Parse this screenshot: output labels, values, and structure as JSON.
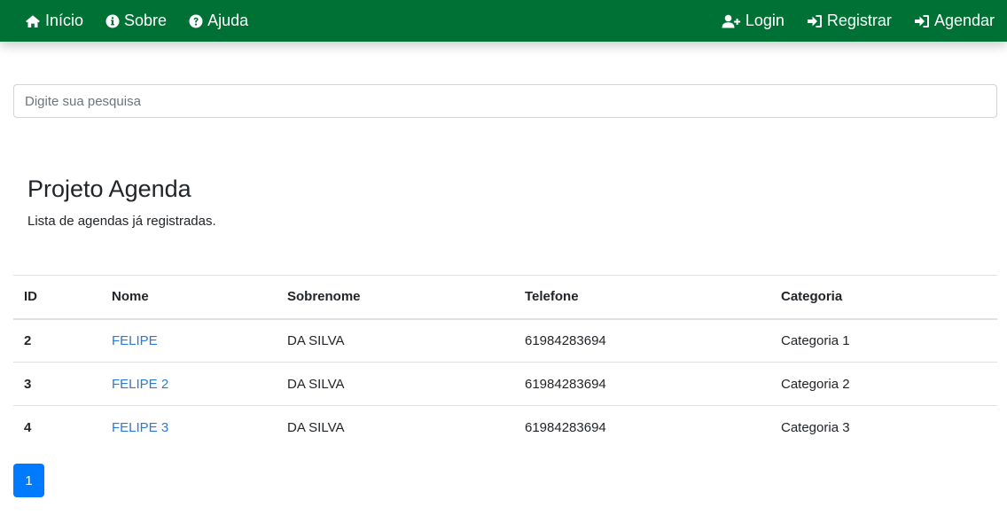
{
  "navbar": {
    "left": [
      {
        "label": "Início",
        "icon": "home-icon"
      },
      {
        "label": "Sobre",
        "icon": "info-circle-icon"
      },
      {
        "label": "Ajuda",
        "icon": "question-circle-icon"
      }
    ],
    "right": [
      {
        "label": "Login",
        "icon": "user-plus-icon"
      },
      {
        "label": "Registrar",
        "icon": "sign-in-icon"
      },
      {
        "label": "Agendar",
        "icon": "sign-in-icon"
      }
    ],
    "background_color": "#007134",
    "text_color": "#ffffff"
  },
  "search": {
    "placeholder": "Digite sua pesquisa",
    "value": ""
  },
  "header": {
    "title": "Projeto Agenda",
    "subtitle": "Lista de agendas já registradas."
  },
  "table": {
    "columns": [
      "ID",
      "Nome",
      "Sobrenome",
      "Telefone",
      "Categoria"
    ],
    "rows": [
      [
        "2",
        "FELIPE",
        "DA SILVA",
        "61984283694",
        "Categoria 1"
      ],
      [
        "3",
        "FELIPE 2",
        "DA SILVA",
        "61984283694",
        "Categoria 2"
      ],
      [
        "4",
        "FELIPE 3",
        "DA SILVA",
        "61984283694",
        "Categoria 3"
      ]
    ],
    "link_color": "#2a7ad3"
  },
  "pagination": {
    "pages": [
      "1"
    ],
    "current": "1",
    "active_color": "#007bff"
  }
}
